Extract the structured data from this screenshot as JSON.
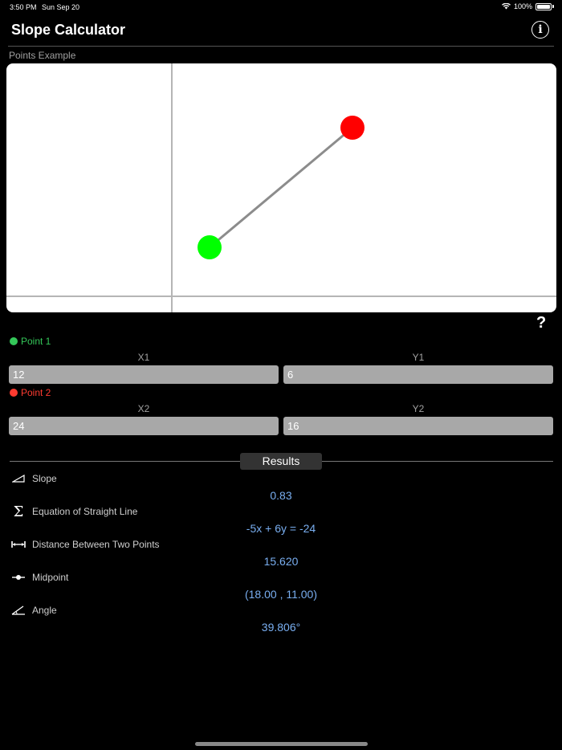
{
  "status_bar": {
    "time": "3:50 PM",
    "date": "Sun Sep 20",
    "battery": "100%"
  },
  "header": {
    "title": "Slope Calculator",
    "info_icon": "i"
  },
  "graph": {
    "section_label": "Points Example"
  },
  "help_label": "?",
  "point1": {
    "label": "Point 1",
    "color": "#34c759",
    "x_label": "X1",
    "y_label": "Y1",
    "x_value": "12",
    "y_value": "6"
  },
  "point2": {
    "label": "Point 2",
    "color": "#ff3b30",
    "x_label": "X2",
    "y_label": "Y2",
    "x_value": "24",
    "y_value": "16"
  },
  "results": {
    "tab_label": "Results",
    "items": [
      {
        "icon": "slope-icon",
        "label": "Slope",
        "value": "0.83"
      },
      {
        "icon": "sigma-icon",
        "label": "Equation of Straight Line",
        "value": "-5x + 6y = -24"
      },
      {
        "icon": "distance-icon",
        "label": "Distance Between Two Points",
        "value": "15.620"
      },
      {
        "icon": "midpoint-icon",
        "label": "Midpoint",
        "value": "(18.00 , 11.00)"
      },
      {
        "icon": "angle-icon",
        "label": "Angle",
        "value": "39.806°"
      }
    ]
  },
  "colors": {
    "accent_value": "#79aef0",
    "graph_point1": "#00ff00",
    "graph_point2": "#ff0000"
  }
}
